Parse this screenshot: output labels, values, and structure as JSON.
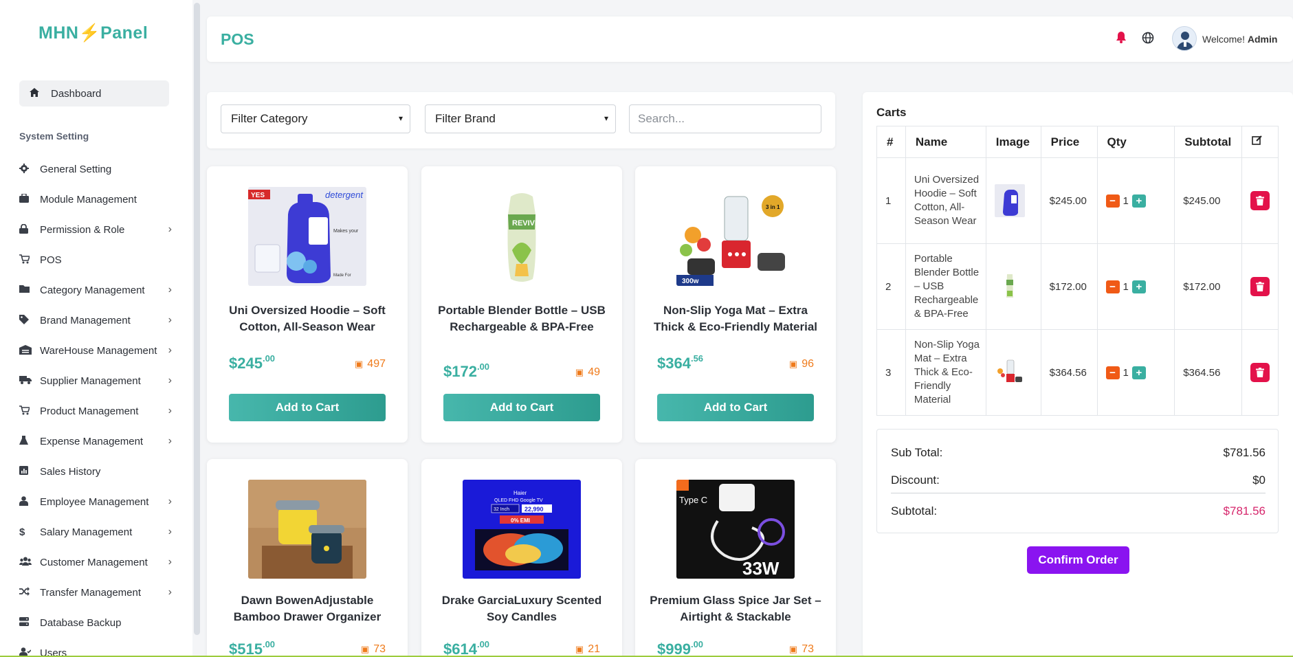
{
  "brand": {
    "name_left": "MHN",
    "bolt": "⚡",
    "name_right": "Panel"
  },
  "sidebar": {
    "dashboard": {
      "label": "Dashboard",
      "icon": "home-icon"
    },
    "section_label": "System Setting",
    "items": [
      {
        "label": "General Setting",
        "icon": "gear-icon",
        "chevron": false
      },
      {
        "label": "Module Management",
        "icon": "briefcase-icon",
        "chevron": false
      },
      {
        "label": "Permission & Role",
        "icon": "lock-icon",
        "chevron": true
      },
      {
        "label": "POS",
        "icon": "cart-icon",
        "chevron": false
      },
      {
        "label": "Category Management",
        "icon": "folder-icon",
        "chevron": true
      },
      {
        "label": "Brand Management",
        "icon": "tag-icon",
        "chevron": true
      },
      {
        "label": "WareHouse Management",
        "icon": "warehouse-icon",
        "chevron": true
      },
      {
        "label": "Supplier Management",
        "icon": "truck-icon",
        "chevron": true
      },
      {
        "label": "Product Management",
        "icon": "cart-icon",
        "chevron": true
      },
      {
        "label": "Expense Management",
        "icon": "flask-icon",
        "chevron": true
      },
      {
        "label": "Sales History",
        "icon": "chart-icon",
        "chevron": false
      },
      {
        "label": "Employee Management",
        "icon": "user-tie-icon",
        "chevron": true
      },
      {
        "label": "Salary Management",
        "icon": "dollar-icon",
        "chevron": true
      },
      {
        "label": "Customer Management",
        "icon": "users-icon",
        "chevron": true
      },
      {
        "label": "Transfer Management",
        "icon": "shuffle-icon",
        "chevron": true
      },
      {
        "label": "Database Backup",
        "icon": "database-icon",
        "chevron": false
      },
      {
        "label": "Users",
        "icon": "user-check-icon",
        "chevron": false
      }
    ]
  },
  "header": {
    "title": "POS",
    "welcome_prefix": "Welcome!",
    "user": "Admin"
  },
  "filters": {
    "category": "Filter Category",
    "brand": "Filter Brand",
    "search_placeholder": "Search..."
  },
  "products": [
    {
      "name": "Uni Oversized Hoodie – Soft Cotton, All-Season Wear",
      "price_main": "$245",
      "price_cents": ".00",
      "stock": "497",
      "button": "Add to Cart"
    },
    {
      "name": "Portable Blender Bottle – USB Rechargeable & BPA-Free",
      "price_main": "$172",
      "price_cents": ".00",
      "stock": "49",
      "button": "Add to Cart"
    },
    {
      "name": "Non-Slip Yoga Mat – Extra Thick & Eco-Friendly Material",
      "price_main": "$364",
      "price_cents": ".56",
      "stock": "96",
      "button": "Add to Cart"
    },
    {
      "name": "Dawn BowenAdjustable Bamboo Drawer Organizer",
      "price_main": "$515",
      "price_cents": ".00",
      "stock": "73",
      "button": "Add to Cart"
    },
    {
      "name": "Drake GarciaLuxury Scented Soy Candles",
      "price_main": "$614",
      "price_cents": ".00",
      "stock": "21",
      "button": "Add to Cart"
    },
    {
      "name": "Premium Glass Spice Jar Set – Airtight & Stackable",
      "price_main": "$999",
      "price_cents": ".00",
      "stock": "73",
      "button": "Add to Cart"
    }
  ],
  "product_image_text": {
    "p1_tag": "YES",
    "p1_word": "detergent",
    "p2_word": "REVIVE",
    "p3_label": "3 in 1",
    "p3_watt": "300w",
    "p5_brand": "Haier",
    "p5_line1": "QLED FHD Google TV",
    "p5_size": "32 Inch",
    "p5_price": "22,990",
    "p5_emi": "0% EMI",
    "p6_title": "Type C",
    "p6_watt": "33W"
  },
  "cart": {
    "title": "Carts",
    "headers": [
      "#",
      "Name",
      "Image",
      "Price",
      "Qty",
      "Subtotal"
    ],
    "rows": [
      {
        "num": "1",
        "name": "Uni Oversized Hoodie – Soft Cotton, All-Season Wear",
        "price": "$245.00",
        "qty": "1",
        "subtotal": "$245.00"
      },
      {
        "num": "2",
        "name": "Portable Blender Bottle – USB Rechargeable & BPA-Free",
        "price": "$172.00",
        "qty": "1",
        "subtotal": "$172.00"
      },
      {
        "num": "3",
        "name": "Non-Slip Yoga Mat – Extra Thick & Eco-Friendly Material",
        "price": "$364.56",
        "qty": "1",
        "subtotal": "$364.56"
      }
    ],
    "summary": {
      "sub_total_label": "Sub Total:",
      "sub_total": "$781.56",
      "discount_label": "Discount:",
      "discount": "$0",
      "subtotal_label": "Subtotal:",
      "subtotal": "$781.56"
    },
    "confirm_label": "Confirm Order"
  },
  "colors": {
    "accent": "#3aafa1",
    "danger": "#e3124a",
    "confirm": "#8a14f0",
    "stock": "#ef7a1a"
  }
}
